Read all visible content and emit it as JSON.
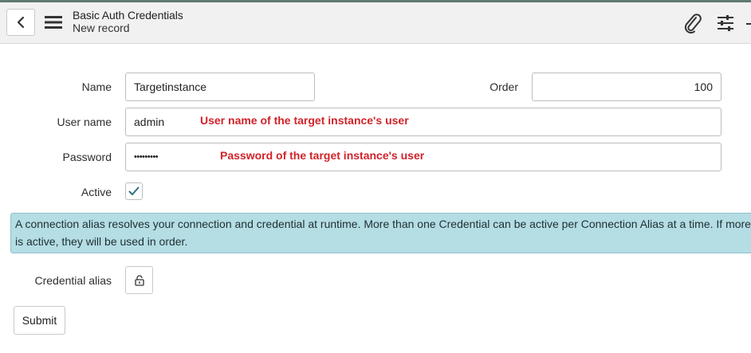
{
  "header": {
    "title": "Basic Auth Credentials",
    "subtitle": "New record",
    "icons": [
      "back-icon",
      "hamburger-menu-icon",
      "paperclip-icon",
      "sliders-icon",
      "more-icon"
    ]
  },
  "form": {
    "name_label": "Name",
    "name_value": "Targetinstance",
    "order_label": "Order",
    "order_value": "100",
    "username_label": "User name",
    "username_value": "admin",
    "username_annotation": "User name of the target instance's user",
    "password_label": "Password",
    "password_value": "•••••••••",
    "password_annotation": "Password of the target instance's user",
    "active_label": "Active",
    "active_checked": true,
    "info_line1": "A connection alias resolves your connection and credential at runtime. More than one Credential can be active per Connection Alias at a time. If more than one",
    "info_line2": "is active, they will be used in order.",
    "credential_alias_label": "Credential alias",
    "submit_label": "Submit"
  },
  "colors": {
    "annotation": "#d1232a",
    "info_bg": "#b4dde4",
    "header_bg": "#f1f1f1",
    "checkmark": "#2e6e7d"
  }
}
